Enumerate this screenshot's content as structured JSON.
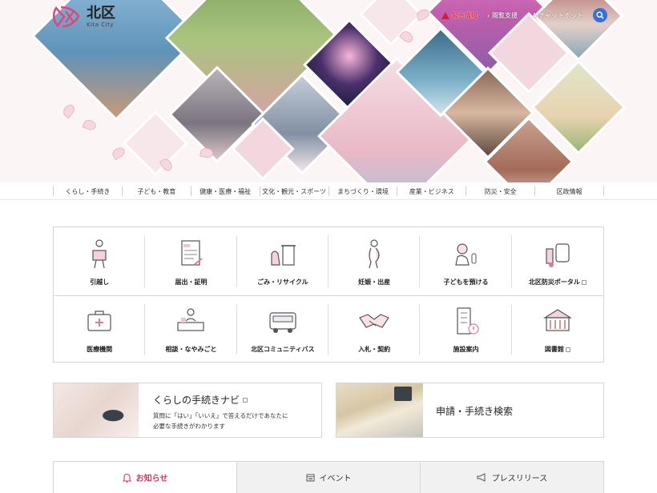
{
  "header": {
    "logo_jp": "北区",
    "logo_en": "Kita City",
    "utility": {
      "emergency": "緊急情報",
      "accessibility": "閲覧支援",
      "ai_chat": "AIチャットボット"
    },
    "colors": {
      "accent": "#d13b62",
      "emergency": "#d3202a",
      "search": "#3a6fd8"
    }
  },
  "nav": [
    "くらし・手続き",
    "子ども・教育",
    "健康・医療・福祉",
    "文化・観光・スポーツ",
    "まちづくり・環境",
    "産業・ビジネス",
    "防災・安全",
    "区政情報"
  ],
  "quick_links": [
    {
      "label": "引越し",
      "icon": "moving-person-icon",
      "external": false
    },
    {
      "label": "届出・証明",
      "icon": "document-icon",
      "external": false
    },
    {
      "label": "ごみ・リサイクル",
      "icon": "trash-bin-icon",
      "external": false
    },
    {
      "label": "妊娠・出産",
      "icon": "pregnancy-icon",
      "external": false
    },
    {
      "label": "子どもを預ける",
      "icon": "baby-icon",
      "external": false
    },
    {
      "label": "北区防災ポータル",
      "icon": "emergency-kit-icon",
      "external": true
    },
    {
      "label": "医療機関",
      "icon": "medical-bag-icon",
      "external": false
    },
    {
      "label": "相談・なやみごと",
      "icon": "consultation-desk-icon",
      "external": false
    },
    {
      "label": "北区コミュニティバス",
      "icon": "bus-icon",
      "external": false
    },
    {
      "label": "入札・契約",
      "icon": "handshake-icon",
      "external": false
    },
    {
      "label": "施設案内",
      "icon": "facility-building-icon",
      "external": false
    },
    {
      "label": "図書館",
      "icon": "library-icon",
      "external": true
    }
  ],
  "banners": {
    "navi": {
      "title": "くらしの手続きナビ",
      "desc_line1": "質問に「はい」「いいえ」で答えるだけであなたに",
      "desc_line2": "必要な手続きがわかります"
    },
    "search": {
      "title": "申請・手続き検索"
    }
  },
  "tabs": [
    {
      "label": "お知らせ",
      "icon": "bell-icon",
      "active": true
    },
    {
      "label": "イベント",
      "icon": "calendar-icon",
      "active": false
    },
    {
      "label": "プレスリリース",
      "icon": "megaphone-icon",
      "active": false
    }
  ]
}
